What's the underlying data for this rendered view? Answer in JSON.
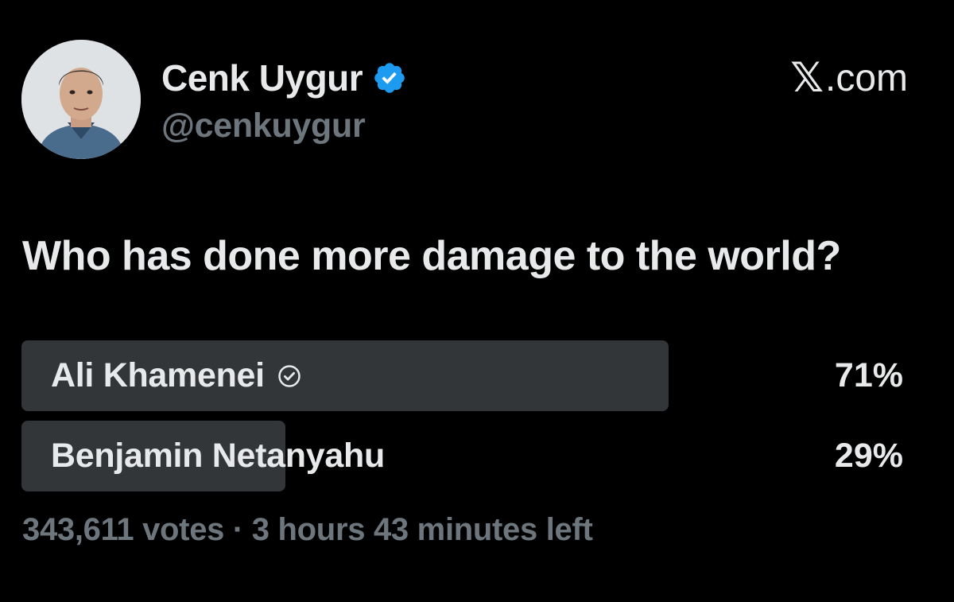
{
  "author": {
    "display_name": "Cenk Uygur",
    "handle": "@cenkuygur",
    "verified_color": "#1d9bf0"
  },
  "brand": {
    "label": ".com",
    "icon": "x-logo-icon"
  },
  "post": {
    "question": "Who has done more damage to the world?"
  },
  "poll": {
    "options": [
      {
        "label": "Ali Khamenei",
        "percent_text": "71%",
        "percent": 71,
        "selected": true
      },
      {
        "label": "Benjamin Netanyahu",
        "percent_text": "29%",
        "percent": 29,
        "selected": false
      }
    ],
    "votes": "343,611 votes",
    "separator": "·",
    "time_left": "3 hours 43 minutes left",
    "bar_color": "#333639"
  }
}
